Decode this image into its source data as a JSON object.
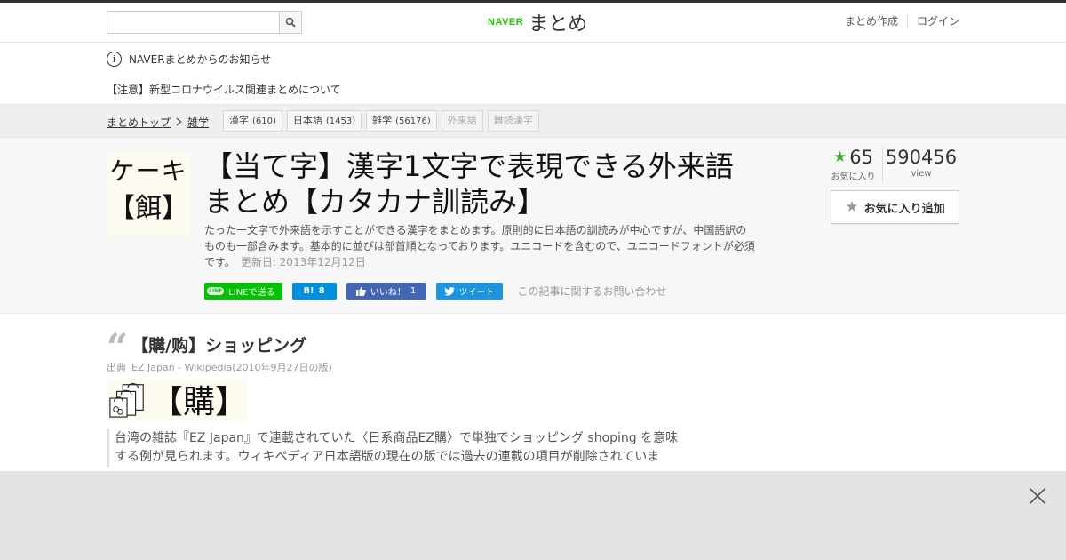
{
  "header": {
    "search_placeholder": "",
    "logo_naver": "NAVER",
    "logo_matome": "まとめ",
    "links": [
      "まとめ作成",
      "ログイン"
    ]
  },
  "notice": {
    "title": "NAVERまとめからのお知らせ",
    "link": "【注意】新型コロナウイルス関連まとめについて"
  },
  "breadcrumb": {
    "home": "まとめトップ",
    "category": "雑学"
  },
  "tags": [
    {
      "label": "漢字",
      "count": "(610)"
    },
    {
      "label": "日本語",
      "count": "(1453)"
    },
    {
      "label": "雑学",
      "count": "(56176)"
    },
    {
      "label": "外来語",
      "count": ""
    },
    {
      "label": "難読漢字",
      "count": ""
    }
  ],
  "article": {
    "thumb_line1": "ケーキ",
    "thumb_line2": "【餌】",
    "title": "【当て字】漢字1文字で表現できる外来語まとめ【カタカナ訓読み】",
    "description": "たった一文字で外来語を示すことができる漢字をまとめます。原則的に日本語の訓読みが中心ですが、中国語訳のものも一部含みます。基本的に並びは部首順となっております。ユニコードを含むので、ユニコードフォントが必須です。",
    "updated": "更新日: 2013年12月12日",
    "fav_count": "65",
    "fav_label": "お気に入り",
    "view_count": "590456",
    "view_label": "view",
    "fav_button": "お気に入り追加"
  },
  "share": {
    "line_badge": "LINE",
    "line": "LINEで送る",
    "hatena_icon": "B!",
    "hatena_count": "8",
    "fb_label": "いいね！",
    "fb_count": "1",
    "tweet": "ツイート",
    "inquiry": "この記事に関するお問い合わせ"
  },
  "section": {
    "heading": "【購/购】ショッピング",
    "source_label": "出典",
    "source": "EZ Japan - Wikipedia(2010年9月27日の版)",
    "image_kanji": "【購】",
    "quote": "台湾の雑誌『EZ Japan』で連載されていた〈日系商品EZ購〉で単独でショッピング shoping を意味する例が見られます。ウィキペディア日本語版の現在の版では過去の連載の項目が削除されていま"
  },
  "colors": {
    "brand_green": "#1ec800",
    "star_green": "#3eaf2c",
    "line_green": "#00c300",
    "hatena_blue": "#008fde",
    "facebook_blue": "#4267b2",
    "twitter_blue": "#1b95e0"
  },
  "icons": [
    "search-icon",
    "info-icon",
    "chevron-right-icon",
    "star-icon",
    "line-icon",
    "hatena-icon",
    "facebook-like-icon",
    "twitter-icon",
    "quote-icon",
    "shopping-bags-icon",
    "close-icon"
  ]
}
